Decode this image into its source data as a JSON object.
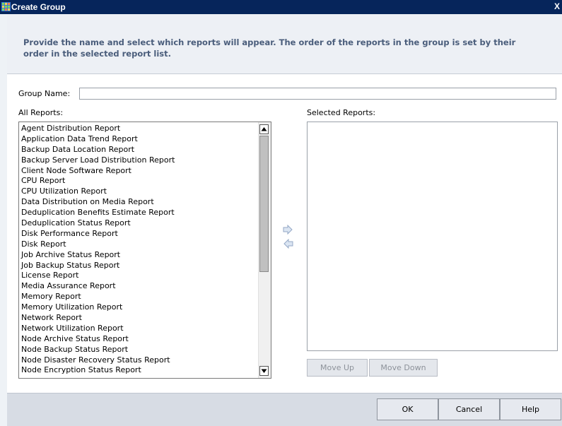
{
  "window": {
    "title": "Create Group",
    "close_glyph": "X",
    "app_icon": "grid-app-icon"
  },
  "header": {
    "instruction": "Provide the name and select which reports will appear.  The order of the reports in the group is set by their order in the selected report list."
  },
  "group_name": {
    "label": "Group Name:",
    "value": ""
  },
  "all_reports": {
    "label": "All Reports:",
    "items": [
      "Agent Distribution Report",
      "Application Data Trend Report",
      "Backup Data Location Report",
      "Backup Server Load Distribution Report",
      "Client Node Software Report",
      "CPU Report",
      "CPU Utilization Report",
      "Data Distribution on Media Report",
      "Deduplication Benefits Estimate Report",
      "Deduplication Status Report",
      "Disk Performance Report",
      "Disk Report",
      "Job Archive Status Report",
      "Job Backup Status Report",
      "License Report",
      "Media Assurance Report",
      "Memory Report",
      "Memory Utilization Report",
      "Network Report",
      "Network Utilization Report",
      "Node Archive Status Report",
      "Node Backup Status Report",
      "Node Disaster Recovery Status Report",
      "Node Encryption Status Report"
    ]
  },
  "selected_reports": {
    "label": "Selected Reports:",
    "items": []
  },
  "transfer": {
    "add_icon": "arrow-right-icon",
    "remove_icon": "arrow-left-icon"
  },
  "order_buttons": {
    "move_up": "Move Up",
    "move_down": "Move Down"
  },
  "footer": {
    "ok": "OK",
    "cancel": "Cancel",
    "help": "Help"
  },
  "colors": {
    "titlebar": "#06255b",
    "header_bg": "#edf0f5",
    "instruction_text": "#4a5d7b",
    "footer_bg": "#d7dce4"
  }
}
